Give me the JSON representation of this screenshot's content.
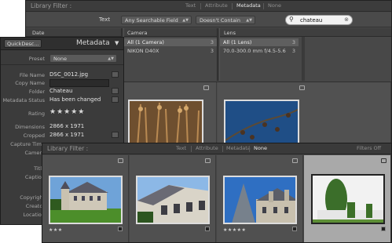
{
  "back_window": {
    "filter_label": "Library Filter :",
    "tabs": [
      "Text",
      "Attribute",
      "Metadata",
      "None"
    ],
    "selected_tab": "Metadata",
    "text_label": "Text",
    "field_dropdown": "Any Searchable Field",
    "rule_dropdown": "Doesn't Contain",
    "search_value": "chateau",
    "columns": [
      {
        "header": "Date",
        "rows": []
      },
      {
        "header": "Camera",
        "rows": [
          {
            "label": "All (1 Camera)",
            "count": "3",
            "selected": true
          },
          {
            "label": "NIKON D40X",
            "count": "3",
            "selected": false
          }
        ]
      },
      {
        "header": "Lens",
        "rows": [
          {
            "label": "All (1 Lens)",
            "count": "3",
            "selected": true
          },
          {
            "label": "70.0-300.0 mm f/4.5-5.6",
            "count": "3",
            "selected": false
          }
        ]
      }
    ]
  },
  "metadata_panel": {
    "quick_describe": "QuickDesc...",
    "title": "Metadata",
    "preset_label": "Preset",
    "preset_value": "None",
    "fields": [
      {
        "label": "File Name",
        "value": "DSC_0012.jpg"
      },
      {
        "label": "Copy Name",
        "value": ""
      },
      {
        "label": "Folder",
        "value": "Chateau"
      },
      {
        "label": "Metadata Status",
        "value": "Has been changed"
      }
    ],
    "rating_label": "Rating",
    "rating_value": 5,
    "rating_stars": "★★★★★",
    "dimension_fields": [
      {
        "label": "Dimensions",
        "value": "2866 x 1971"
      },
      {
        "label": "Cropped",
        "value": "2866 x 1971"
      },
      {
        "label": "Capture Time",
        "value": ""
      },
      {
        "label": "Camera",
        "value": ""
      }
    ],
    "partial_labels": [
      "Title",
      "Caption",
      "Copyright",
      "Creator",
      "Location"
    ]
  },
  "front_window": {
    "filter_label": "Library Filter :",
    "tabs": [
      "Text",
      "Attribute",
      "Metadata",
      "None"
    ],
    "selected_tab": "None",
    "filters_off": "Filters Off",
    "thumbnails": [
      {
        "rating_stars": "★★★",
        "rating": 3,
        "selected": false
      },
      {
        "rating_stars": "",
        "rating": 0,
        "selected": false
      },
      {
        "rating_stars": "★★★★★",
        "rating": 5,
        "selected": false
      },
      {
        "rating_stars": "",
        "rating": 0,
        "selected": true
      }
    ]
  },
  "colors": {
    "panel_dark": "#3b3b3b",
    "window_bg": "#474747",
    "selection": "#a9a9a9",
    "search_bg": "#f2f2f2"
  }
}
